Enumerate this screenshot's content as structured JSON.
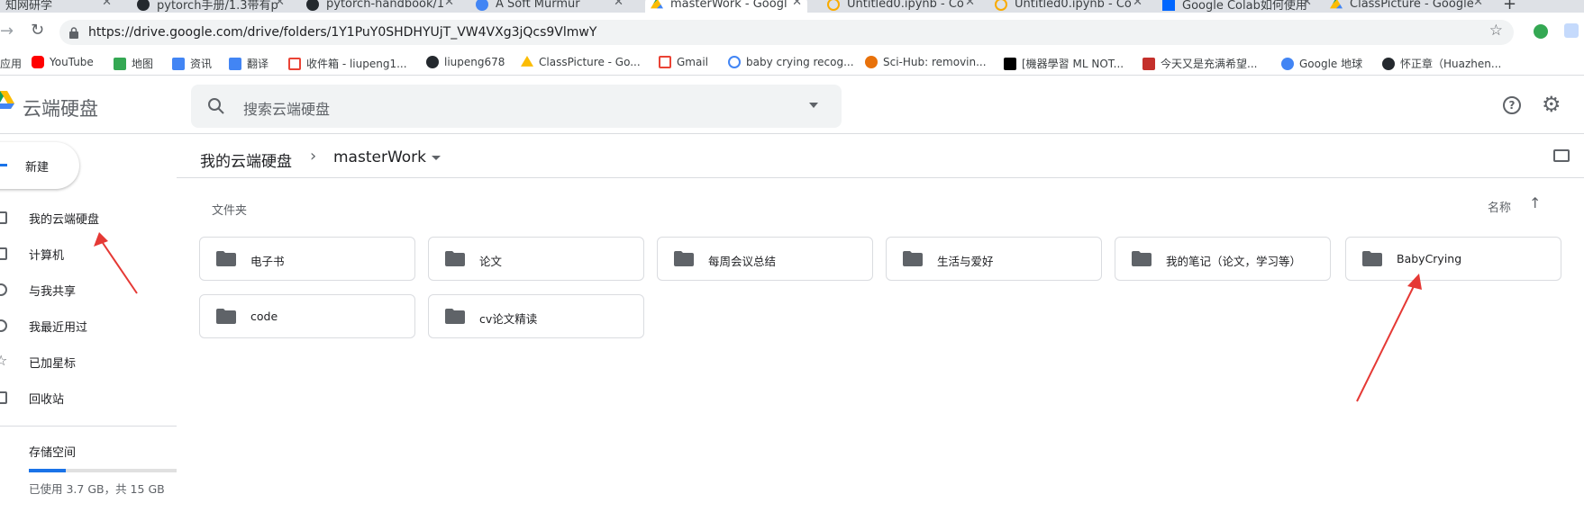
{
  "tabs": [
    {
      "label": "知网研学"
    },
    {
      "label": "pytorch手册/1.3带有p"
    },
    {
      "label": "pytorch-handbook/1"
    },
    {
      "label": "A Soft Murmur"
    },
    {
      "label": "masterWork - Googl"
    },
    {
      "label": "Untitled0.ipynb - Co"
    },
    {
      "label": "Untitled0.ipynb - Co"
    },
    {
      "label": "Google Colab如何使用"
    },
    {
      "label": "ClassPicture - Google"
    }
  ],
  "address_bar": {
    "url": "https://drive.google.com/drive/folders/1Y1PuY0SHDHYUjT_VW4VXg3jQcs9VlmwY"
  },
  "bookmarks": [
    {
      "label": "应用",
      "color": "#1a73e8"
    },
    {
      "label": "YouTube",
      "color": "#ff0000"
    },
    {
      "label": "地图",
      "color": "#34a853"
    },
    {
      "label": "资讯",
      "color": "#4285f4"
    },
    {
      "label": "翻译",
      "color": "#4285f4"
    },
    {
      "label": "收件箱 - liupeng1...",
      "color": "#ea4335"
    },
    {
      "label": "liupeng678",
      "color": "#24292e"
    },
    {
      "label": "ClassPicture - Go...",
      "color": "#fbbc04"
    },
    {
      "label": "Gmail",
      "color": "#ea4335"
    },
    {
      "label": "baby crying recog...",
      "color": "#4285f4"
    },
    {
      "label": "Sci-Hub: removin...",
      "color": "#e8710a"
    },
    {
      "label": "[機器學習 ML NOT...",
      "color": "#000000"
    },
    {
      "label": "今天又是充满希望...",
      "color": "#c4302b"
    },
    {
      "label": "Google 地球",
      "color": "#4285f4"
    },
    {
      "label": "怀正章（Huazhen...",
      "color": "#24292e"
    }
  ],
  "drive": {
    "logo_text": "云端硬盘",
    "search_placeholder": "搜索云端硬盘",
    "new_button": "新建",
    "nav": [
      {
        "label": "我的云端硬盘"
      },
      {
        "label": "计算机"
      },
      {
        "label": "与我共享"
      },
      {
        "label": "我最近用过"
      },
      {
        "label": "已加星标"
      },
      {
        "label": "回收站"
      }
    ],
    "storage": {
      "label": "存储空间",
      "used_text": "已使用 3.7 GB，共 15 GB",
      "used_fraction": 0.247
    },
    "breadcrumb": {
      "root": "我的云端硬盘",
      "current": "masterWork"
    },
    "section_label": "文件夹",
    "sort_label": "名称",
    "folders": [
      {
        "name": "电子书"
      },
      {
        "name": "论文"
      },
      {
        "name": "每周会议总结"
      },
      {
        "name": "生活与爱好"
      },
      {
        "name": "我的笔记（论文，学习等）"
      },
      {
        "name": "BabyCrying"
      },
      {
        "name": "code"
      },
      {
        "name": "cv论文精读"
      }
    ]
  },
  "colors": {
    "accent": "#1a73e8",
    "annotation": "#e53935",
    "folder_icon": "#5f6368"
  }
}
